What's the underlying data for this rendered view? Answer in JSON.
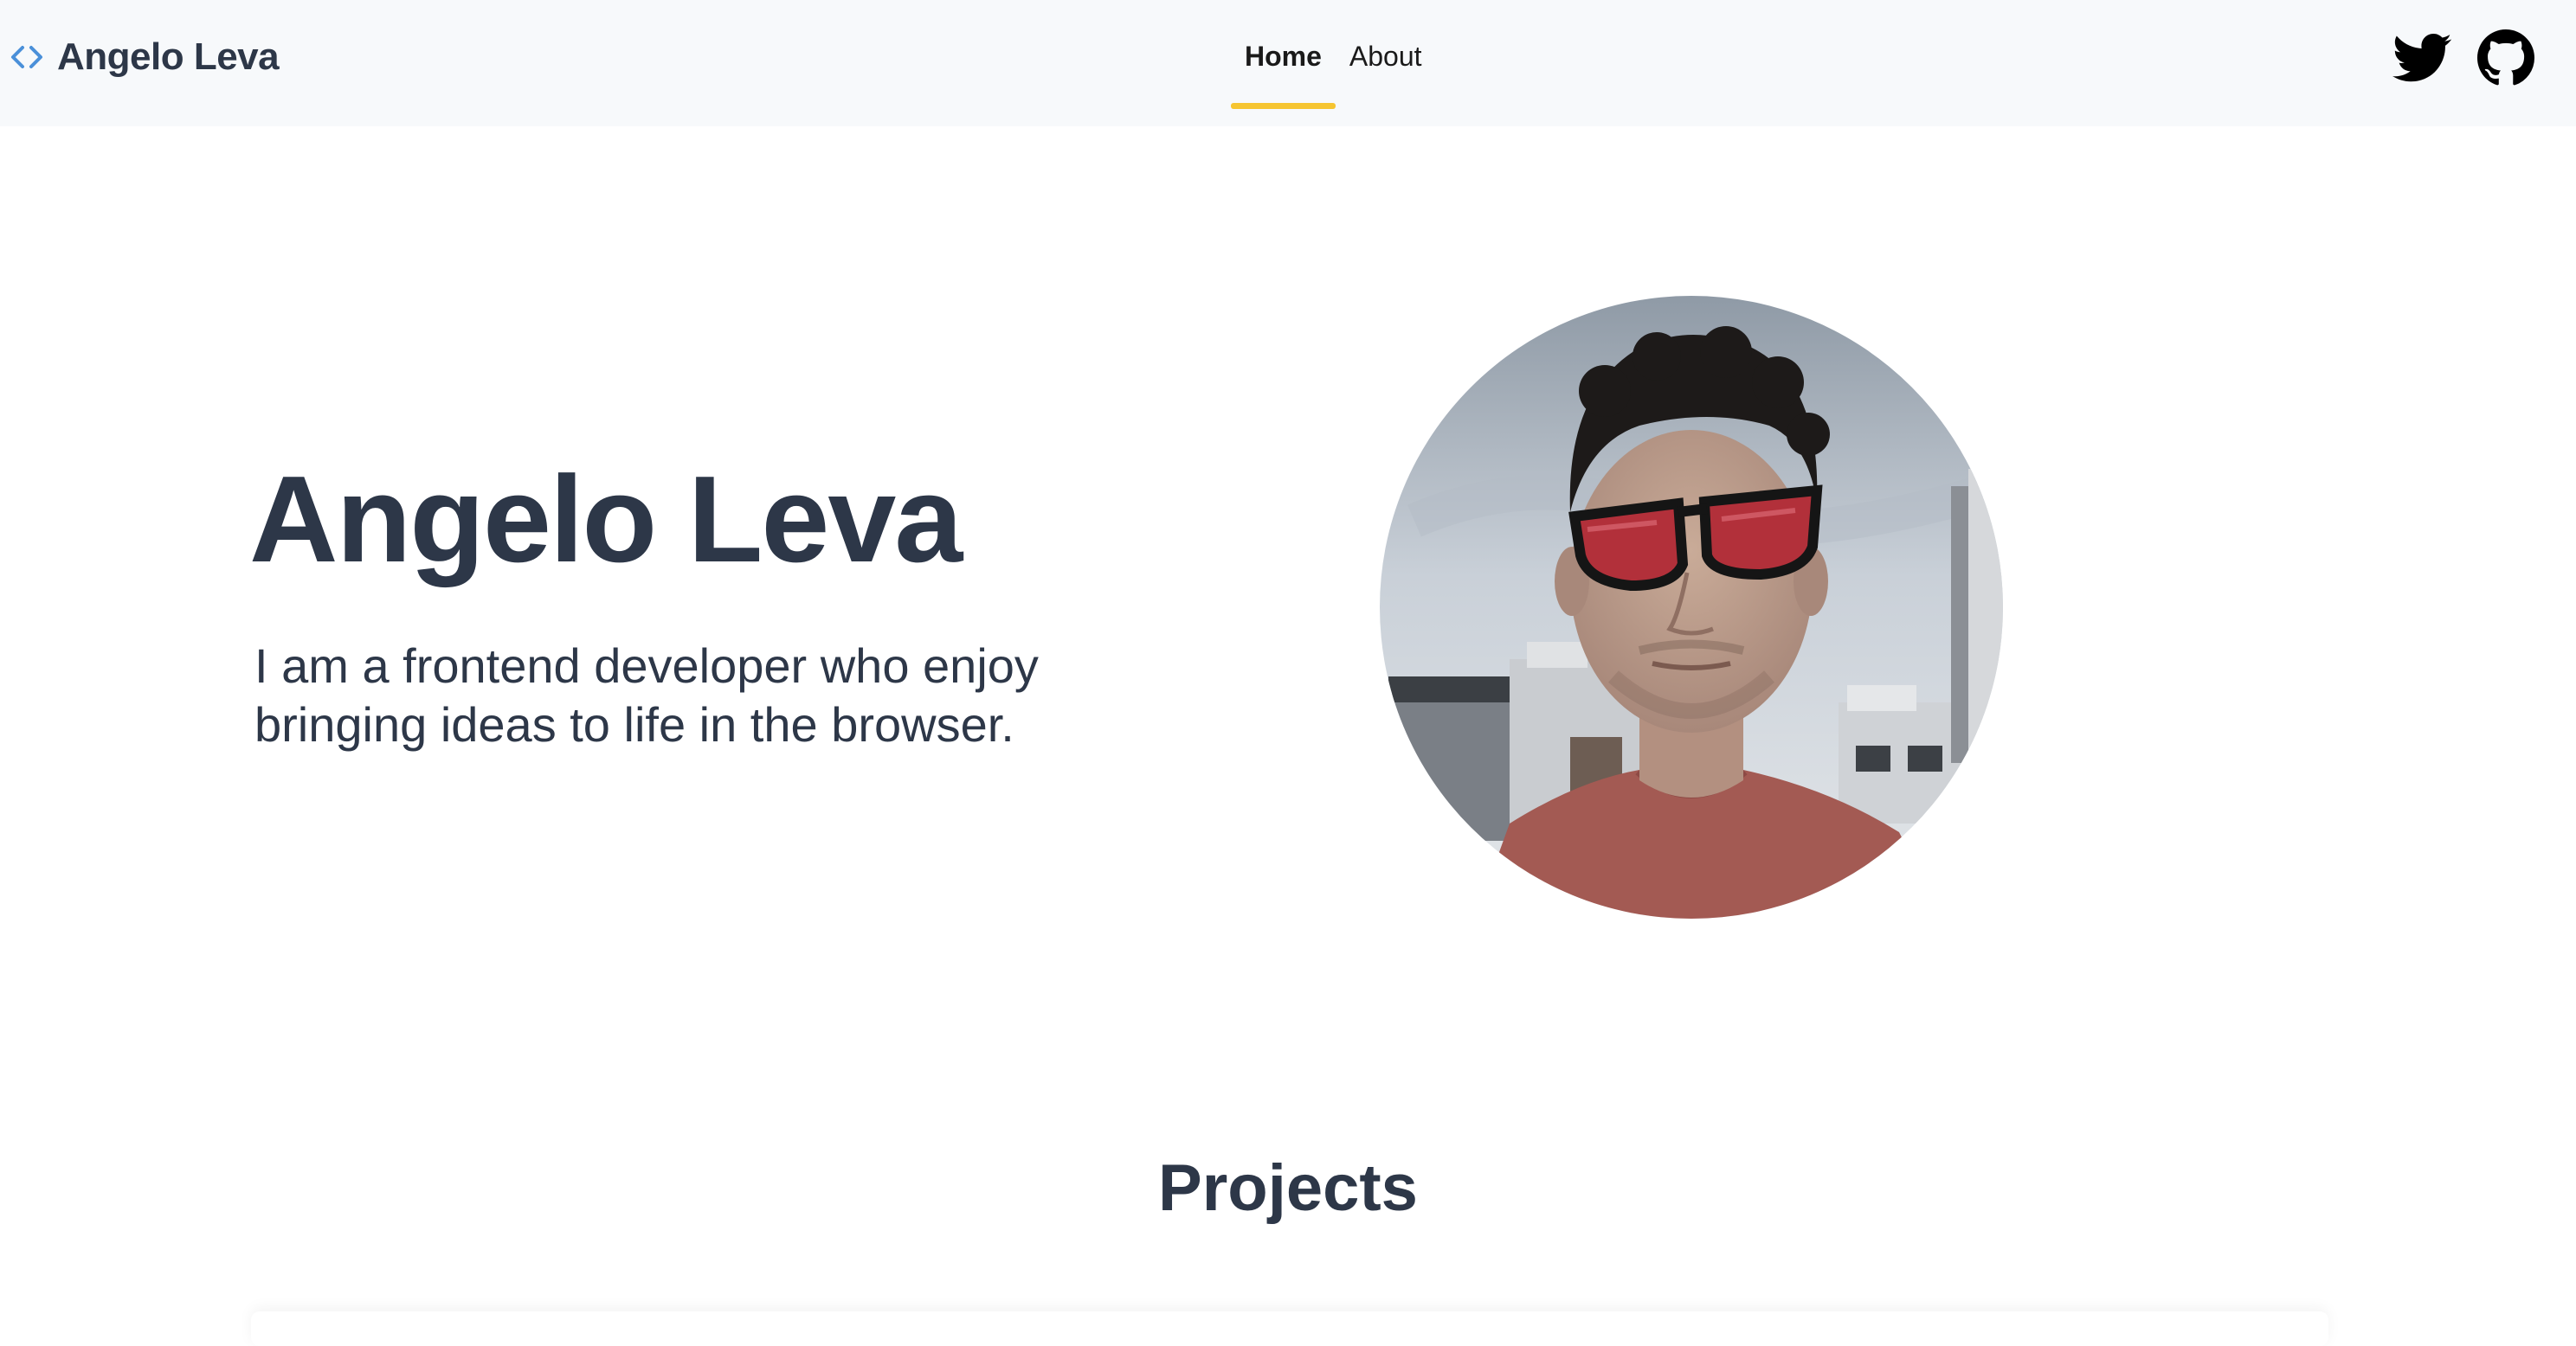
{
  "navbar": {
    "brand_name": "Angelo Leva",
    "brand_icon": "code-brackets-icon",
    "links": [
      {
        "label": "Home",
        "active": true
      },
      {
        "label": "About",
        "active": false
      }
    ],
    "social_icons": [
      "twitter-icon",
      "github-icon"
    ],
    "accent_color": "#f6c531",
    "brand_icon_color": "#4a90d9"
  },
  "hero": {
    "title": "Angelo Leva",
    "subtitle": "I am a frontend developer who enjoy bringing ideas to life in the browser."
  },
  "projects": {
    "title": "Projects"
  }
}
